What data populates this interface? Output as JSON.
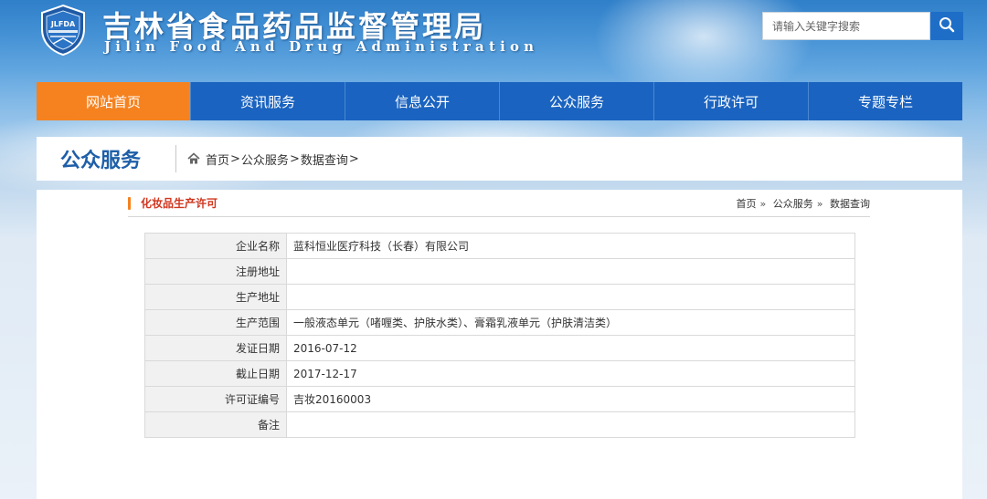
{
  "header": {
    "title": "吉林省食品药品监督管理局",
    "subtitle": "Jilin Food And Drug Administration",
    "logo_text": "JLFDA",
    "search_placeholder": "请输入关键字搜索"
  },
  "nav": {
    "items": [
      {
        "label": "网站首页",
        "active": true
      },
      {
        "label": "资讯服务",
        "active": false
      },
      {
        "label": "信息公开",
        "active": false
      },
      {
        "label": "公众服务",
        "active": false
      },
      {
        "label": "行政许可",
        "active": false
      },
      {
        "label": "专题专栏",
        "active": false
      }
    ]
  },
  "section": {
    "title": "公众服务",
    "breadcrumb": [
      "首页",
      "公众服务",
      "数据查询"
    ]
  },
  "panel": {
    "title": "化妆品生产许可",
    "breadcrumb": [
      "首页",
      "公众服务",
      "数据查询"
    ]
  },
  "record": {
    "rows": [
      {
        "label": "企业名称",
        "value": "蓝科恒业医疗科技（长春）有限公司"
      },
      {
        "label": "注册地址",
        "value": ""
      },
      {
        "label": "生产地址",
        "value": ""
      },
      {
        "label": "生产范围",
        "value": "一般液态单元（啫喱类、护肤水类）、膏霜乳液单元（护肤清洁类）"
      },
      {
        "label": "发证日期",
        "value": "2016-07-12"
      },
      {
        "label": "截止日期",
        "value": "2017-12-17"
      },
      {
        "label": "许可证编号",
        "value": "吉妆20160003"
      },
      {
        "label": "备注",
        "value": ""
      }
    ]
  },
  "colors": {
    "nav_bg": "#1a63c0",
    "nav_active": "#f5821f",
    "section_title": "#1e5fa8",
    "panel_title": "#d0361f"
  },
  "icons": {
    "search": "search-icon",
    "home": "home-icon",
    "logo": "shield-logo-icon"
  }
}
